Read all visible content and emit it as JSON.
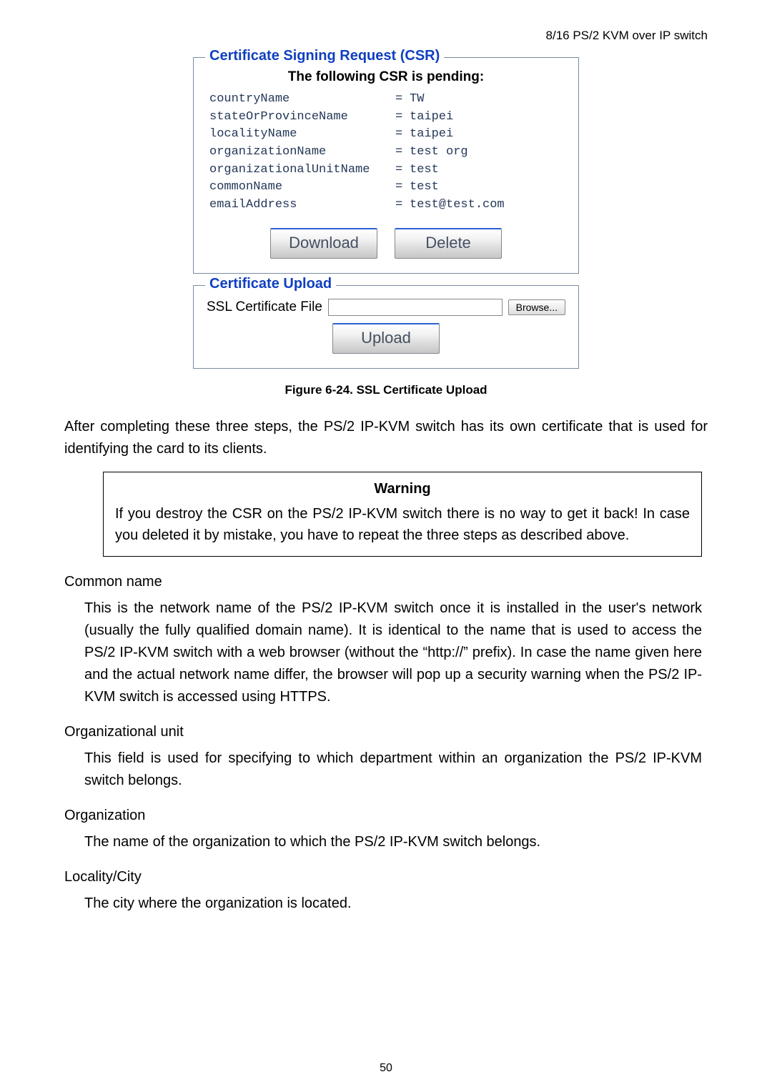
{
  "headerLine": "8/16 PS/2 KVM over IP switch",
  "csr": {
    "legend": "Certificate Signing Request (CSR)",
    "pendingTitle": "The following CSR is pending:",
    "rows": [
      {
        "key": "countryName",
        "val": "TW"
      },
      {
        "key": "stateOrProvinceName",
        "val": "taipei"
      },
      {
        "key": "localityName",
        "val": "taipei"
      },
      {
        "key": "organizationName",
        "val": "test org"
      },
      {
        "key": "organizationalUnitName",
        "val": "test"
      },
      {
        "key": "commonName",
        "val": "test"
      },
      {
        "key": "emailAddress",
        "val": "test@test.com"
      }
    ],
    "downloadBtn": "Download",
    "deleteBtn": "Delete"
  },
  "upload": {
    "legend": "Certificate Upload",
    "label": "SSL Certificate File",
    "browse": "Browse...",
    "uploadBtn": "Upload"
  },
  "figCaption": "Figure 6-24. SSL Certificate Upload",
  "afterPara": "After completing these three steps, the PS/2 IP-KVM switch has its own certificate that is used for identifying the card to its clients.",
  "warning": {
    "title": "Warning",
    "text": "If you destroy the CSR on the PS/2 IP-KVM switch there is no way to get it back! In case you deleted it by mistake, you have to repeat the three steps as described above."
  },
  "terms": [
    {
      "name": "Common name",
      "desc": "This is the network name of the PS/2 IP-KVM switch once it is installed in the user's network (usually the fully qualified domain name). It is identical to the name that is used to access the PS/2 IP-KVM switch with a web browser (without the “http://” prefix). In case the name given here and the actual network name differ, the browser will pop up a security warning when the PS/2 IP-KVM switch is accessed using HTTPS."
    },
    {
      "name": "Organizational unit",
      "desc": "This field is used for specifying to which department within an organization the PS/2 IP-KVM switch belongs."
    },
    {
      "name": "Organization",
      "desc": "The name of the organization to which the PS/2 IP-KVM switch belongs."
    },
    {
      "name": "Locality/City",
      "desc": "The city where the organization is located."
    }
  ],
  "pageNum": "50"
}
